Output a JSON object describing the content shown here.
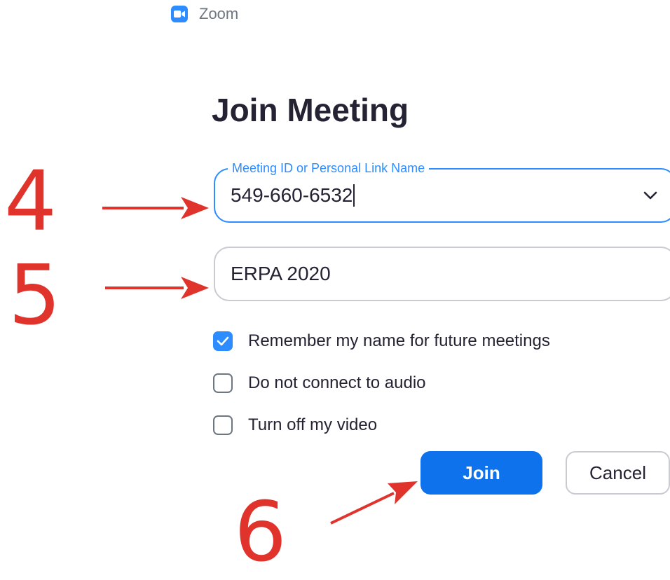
{
  "window": {
    "title": "Zoom",
    "icon": "zoom-camera-icon"
  },
  "dialog": {
    "heading": "Join Meeting",
    "meeting_id_field": {
      "label": "Meeting ID or Personal Link Name",
      "value": "549-660-6532",
      "icon": "chevron-down-icon"
    },
    "name_field": {
      "value": "ERPA 2020"
    },
    "options": [
      {
        "label": "Remember my name for future meetings",
        "checked": true
      },
      {
        "label": "Do not connect to audio",
        "checked": false
      },
      {
        "label": "Turn off my video",
        "checked": false
      }
    ],
    "join_button": "Join",
    "cancel_button": "Cancel"
  },
  "annotations": {
    "steps": [
      "4",
      "5",
      "6"
    ],
    "color": "#e0332c"
  },
  "colors": {
    "accent": "#2d8cff",
    "join_button": "#0e72ed",
    "text": "#232333",
    "annotation": "#e0332c"
  }
}
